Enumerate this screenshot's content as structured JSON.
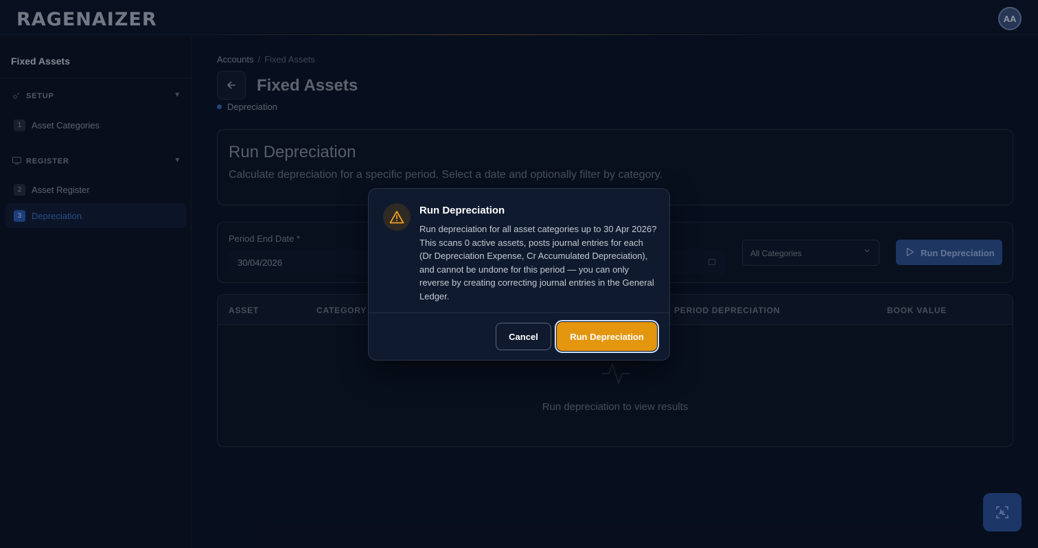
{
  "app": {
    "logo_text": "RAGENAIZER",
    "avatar_initials": "AA"
  },
  "sidebar": {
    "title": "Fixed Assets",
    "sections": [
      {
        "label": "SETUP",
        "items": [
          {
            "num": "1",
            "label": "Asset Categories"
          }
        ]
      },
      {
        "label": "REGISTER",
        "items": [
          {
            "num": "2",
            "label": "Asset Register"
          },
          {
            "num": "3",
            "label": "Depreciation",
            "active": true
          }
        ]
      }
    ]
  },
  "breadcrumb": {
    "parent": "Accounts",
    "separator": "/",
    "current": "Fixed Assets"
  },
  "page": {
    "title": "Fixed Assets",
    "subnav": "Depreciation"
  },
  "run_card": {
    "title": "Run Depreciation",
    "description": "Calculate depreciation for a specific period. Select a date and optionally filter by category."
  },
  "form": {
    "period_label": "Period End Date *",
    "period_value": "30/04/2026",
    "category_selected": "All Categories",
    "run_button": "Run Depreciation"
  },
  "table": {
    "columns": [
      "ASSET",
      "CATEGORY",
      "PERIOD DEPRECIATION",
      "BOOK VALUE"
    ],
    "empty_text": "Run depreciation to view results"
  },
  "modal": {
    "title": "Run Depreciation",
    "body": "Run depreciation for all asset categories up to 30 Apr 2026? This scans 0 active assets, posts journal entries for each (Dr Depreciation Expense, Cr Accumulated Depreciation), and cannot be undone for this period — you can only reverse by creating correcting journal entries in the General Ledger.",
    "cancel_label": "Cancel",
    "confirm_label": "Run Depreciation"
  },
  "colors": {
    "accent": "#2a5bb5",
    "warning": "#e5960f",
    "background": "#0a1124"
  },
  "icons": [
    "back-arrow-icon",
    "gear-icon",
    "monitor-icon",
    "calendar-icon",
    "chevron-down-icon",
    "play-icon",
    "pulse-icon",
    "warning-icon",
    "assistant-icon"
  ]
}
